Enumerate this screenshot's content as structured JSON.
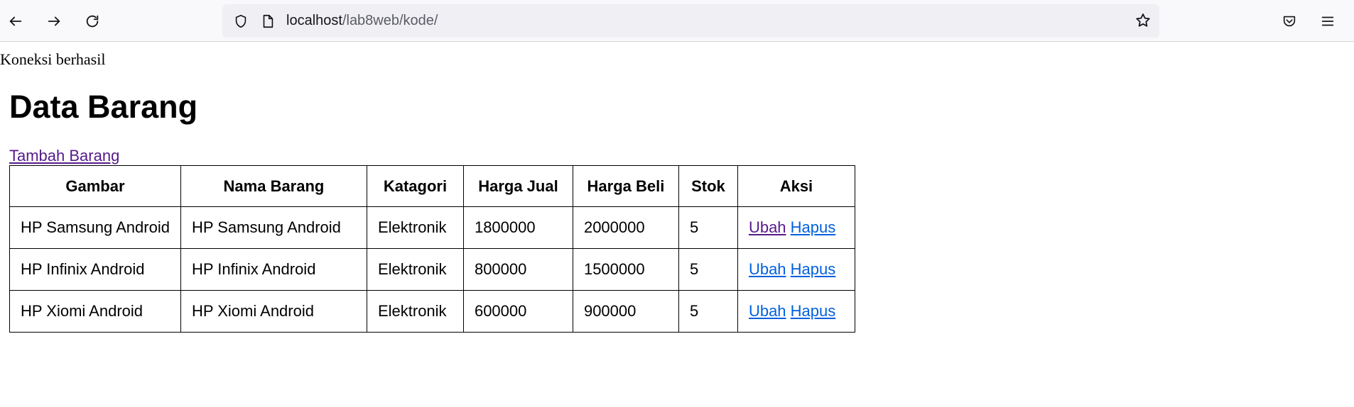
{
  "browser": {
    "url_host": "localhost",
    "url_path": "/lab8web/kode/"
  },
  "page": {
    "status_text": "Koneksi berhasil",
    "title": "Data Barang",
    "add_link": "Tambah Barang",
    "table": {
      "headers": [
        "Gambar",
        "Nama Barang",
        "Katagori",
        "Harga Jual",
        "Harga Beli",
        "Stok",
        "Aksi"
      ],
      "rows": [
        {
          "gambar": "HP Samsung Android",
          "nama": "HP Samsung Android",
          "kategori": "Elektronik",
          "harga_jual": "1800000",
          "harga_beli": "2000000",
          "stok": "5",
          "ubah": "Ubah",
          "hapus": "Hapus"
        },
        {
          "gambar": "HP Infinix Android",
          "nama": "HP Infinix Android",
          "kategori": "Elektronik",
          "harga_jual": "800000",
          "harga_beli": "1500000",
          "stok": "5",
          "ubah": "Ubah",
          "hapus": "Hapus"
        },
        {
          "gambar": "HP Xiomi Android",
          "nama": "HP Xiomi Android",
          "kategori": "Elektronik",
          "harga_jual": "600000",
          "harga_beli": "900000",
          "stok": "5",
          "ubah": "Ubah",
          "hapus": "Hapus"
        }
      ]
    }
  },
  "icons": {
    "back": "back-arrow-icon",
    "forward": "forward-arrow-icon",
    "reload": "reload-icon",
    "shield": "tracking-protection-shield-icon",
    "page": "page-info-icon",
    "star": "bookmark-star-icon",
    "pocket": "pocket-icon",
    "menu": "hamburger-menu-icon"
  }
}
